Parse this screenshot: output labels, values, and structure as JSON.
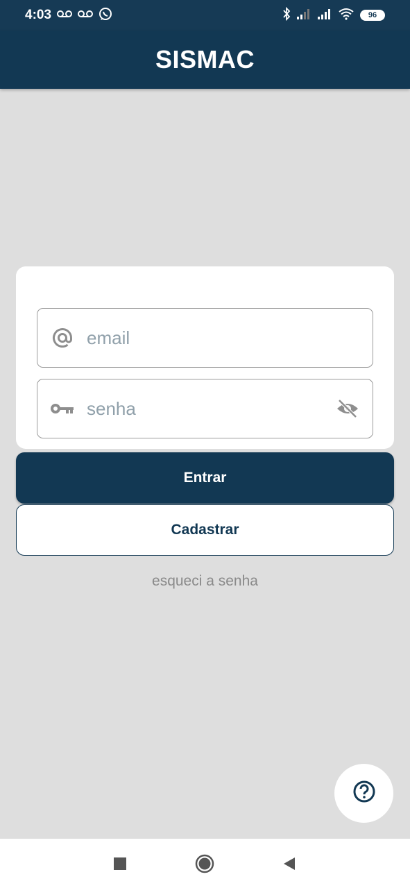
{
  "status_bar": {
    "time": "4:03",
    "battery": "96",
    "left_icons": [
      "voicemail-icon",
      "voicemail-icon",
      "whatsapp-icon"
    ],
    "right_icons": [
      "bluetooth-icon",
      "signal-icon",
      "signal-icon",
      "wifi-icon",
      "battery-icon"
    ]
  },
  "app_bar": {
    "title": "SISMAC"
  },
  "login_form": {
    "email_placeholder": "email",
    "email_value": "",
    "password_placeholder": "senha",
    "password_value": "",
    "email_icon": "at-icon",
    "password_icon": "key-icon",
    "visibility_icon": "eye-off-icon"
  },
  "actions": {
    "login_label": "Entrar",
    "register_label": "Cadastrar",
    "forgot_label": "esqueci a senha"
  },
  "help": {
    "icon": "help-circle-icon"
  },
  "nav_bar": {
    "icons": [
      "recent-apps-icon",
      "home-icon",
      "back-icon"
    ]
  },
  "colors": {
    "primary": "#123853",
    "background": "#dedede",
    "surface": "#ffffff",
    "placeholder": "#90a0aa",
    "muted_text": "#8a8a8a"
  }
}
